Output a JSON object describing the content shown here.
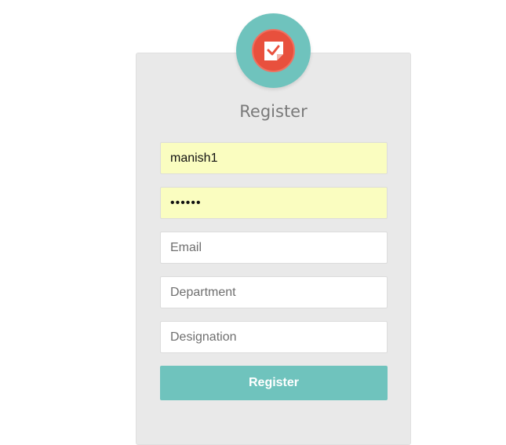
{
  "logo": {
    "icon": "sticky-note-check-icon",
    "ring_color": "#6fc3bd",
    "badge_color": "#e8503d"
  },
  "form": {
    "title": "Register",
    "username": {
      "value": "manish1"
    },
    "password": {
      "value": "••••••"
    },
    "email": {
      "placeholder": "Email",
      "value": ""
    },
    "department": {
      "placeholder": "Department",
      "value": ""
    },
    "designation": {
      "placeholder": "Designation",
      "value": ""
    },
    "submit_label": "Register"
  },
  "colors": {
    "accent": "#6fc3bd",
    "autofill_bg": "#fafdc0",
    "card_bg": "#e9e9e9"
  }
}
